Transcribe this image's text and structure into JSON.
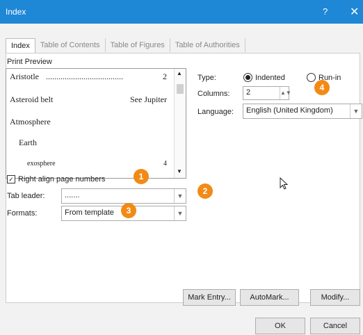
{
  "window": {
    "title": "Index",
    "help_glyph": "?",
    "close_glyph": "✕"
  },
  "tabs": [
    "Index",
    "Table of Contents",
    "Table of Figures",
    "Table of Authorities"
  ],
  "print_preview": {
    "label": "Print Preview",
    "entries": [
      {
        "text": "Aristotle",
        "page": "2"
      },
      {
        "text": "Asteroid belt",
        "page": "See Jupiter"
      },
      {
        "text": "Atmosphere",
        "page": ""
      },
      {
        "text": "Earth",
        "page": ""
      },
      {
        "text": "exosphere",
        "page": "4"
      }
    ]
  },
  "type": {
    "label": "Type:",
    "indented": "Indented",
    "run_in": "Run-in",
    "selected": "Indented"
  },
  "columns": {
    "label": "Columns:",
    "value": "2"
  },
  "language": {
    "label": "Language:",
    "value": "English (United Kingdom)"
  },
  "right_align": {
    "label": "Right align page numbers",
    "checked": true
  },
  "tab_leader": {
    "label": "Tab leader:",
    "value": "......."
  },
  "formats": {
    "label": "Formats:",
    "value": "From template"
  },
  "badges": [
    "1",
    "2",
    "3",
    "4"
  ],
  "buttons": {
    "mark_entry": "Mark Entry...",
    "automark": "AutoMark...",
    "modify": "Modify...",
    "ok": "OK",
    "cancel": "Cancel"
  },
  "colors": {
    "titlebar": "#1e87d6",
    "badge": "#f28a16"
  }
}
